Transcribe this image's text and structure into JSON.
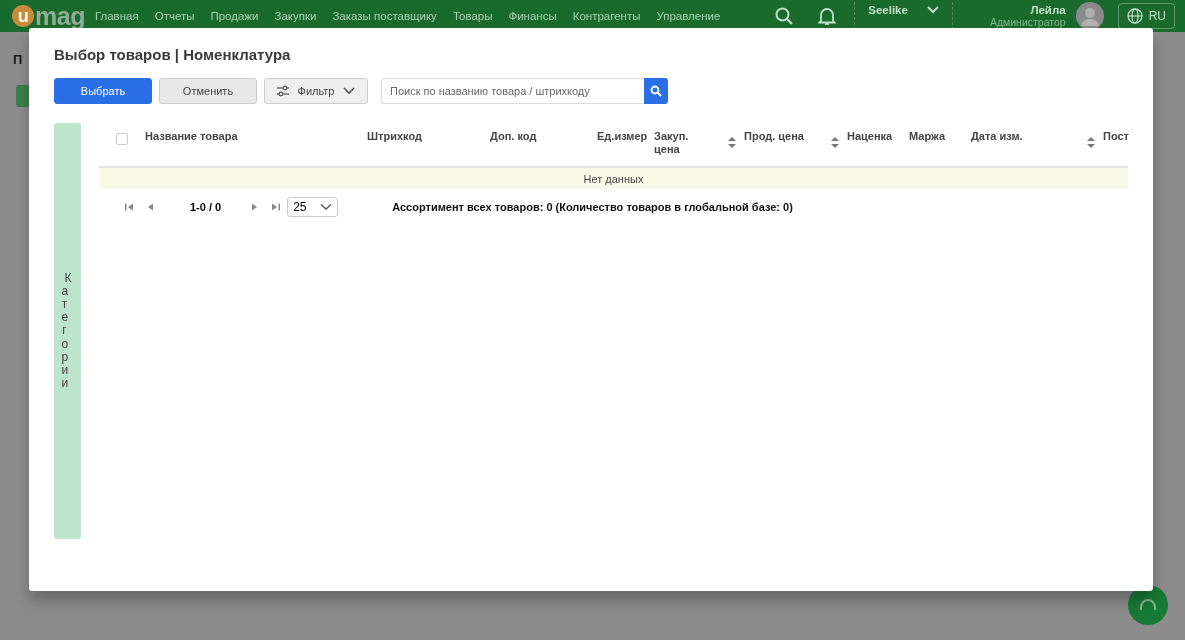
{
  "navbar": {
    "logo": {
      "mark": "u",
      "text": "mag"
    },
    "items": [
      "Главная",
      "Отчеты",
      "Продажи",
      "Закупки",
      "Заказы поставщику",
      "Товары",
      "Финансы",
      "Контрагенты",
      "Управление"
    ],
    "company": "Seelike",
    "user": {
      "name": "Лейла",
      "role": "Администратор"
    },
    "language": "RU"
  },
  "background": {
    "page_title": "П"
  },
  "modal": {
    "title": "Выбор товаров | Номенклатура",
    "buttons": [
      {
        "label": "Выбрать",
        "kind": "primary"
      },
      {
        "label": "Отменить",
        "kind": "secondary"
      },
      {
        "label": "Фильтр",
        "kind": "filter"
      }
    ],
    "search": {
      "placeholder": "Поиск по названию товара / штрихкоду"
    },
    "categories_label": "Категории",
    "table": {
      "select_all_checked": false,
      "columns": [
        {
          "label": "Название товара",
          "sortable": false
        },
        {
          "label": "Штрихкод",
          "sortable": false
        },
        {
          "label": "Доп. код",
          "sortable": false
        },
        {
          "label": "Ед.измер",
          "sortable": false
        },
        {
          "label": "Закуп. цена",
          "sortable": true
        },
        {
          "label": "Прод. цена",
          "sortable": true
        },
        {
          "label": "Наценка",
          "sortable": false
        },
        {
          "label": "Маржа",
          "sortable": false
        },
        {
          "label": "Дата изм.",
          "sortable": true
        },
        {
          "label": "Пост",
          "sortable": false
        }
      ],
      "empty_text": "Нет данных"
    },
    "pagination": {
      "range": "1-0 / 0",
      "page_size": "25"
    },
    "summary": "Ассортимент всех товаров: 0 (Количество товаров в глобальной базе: 0)"
  }
}
